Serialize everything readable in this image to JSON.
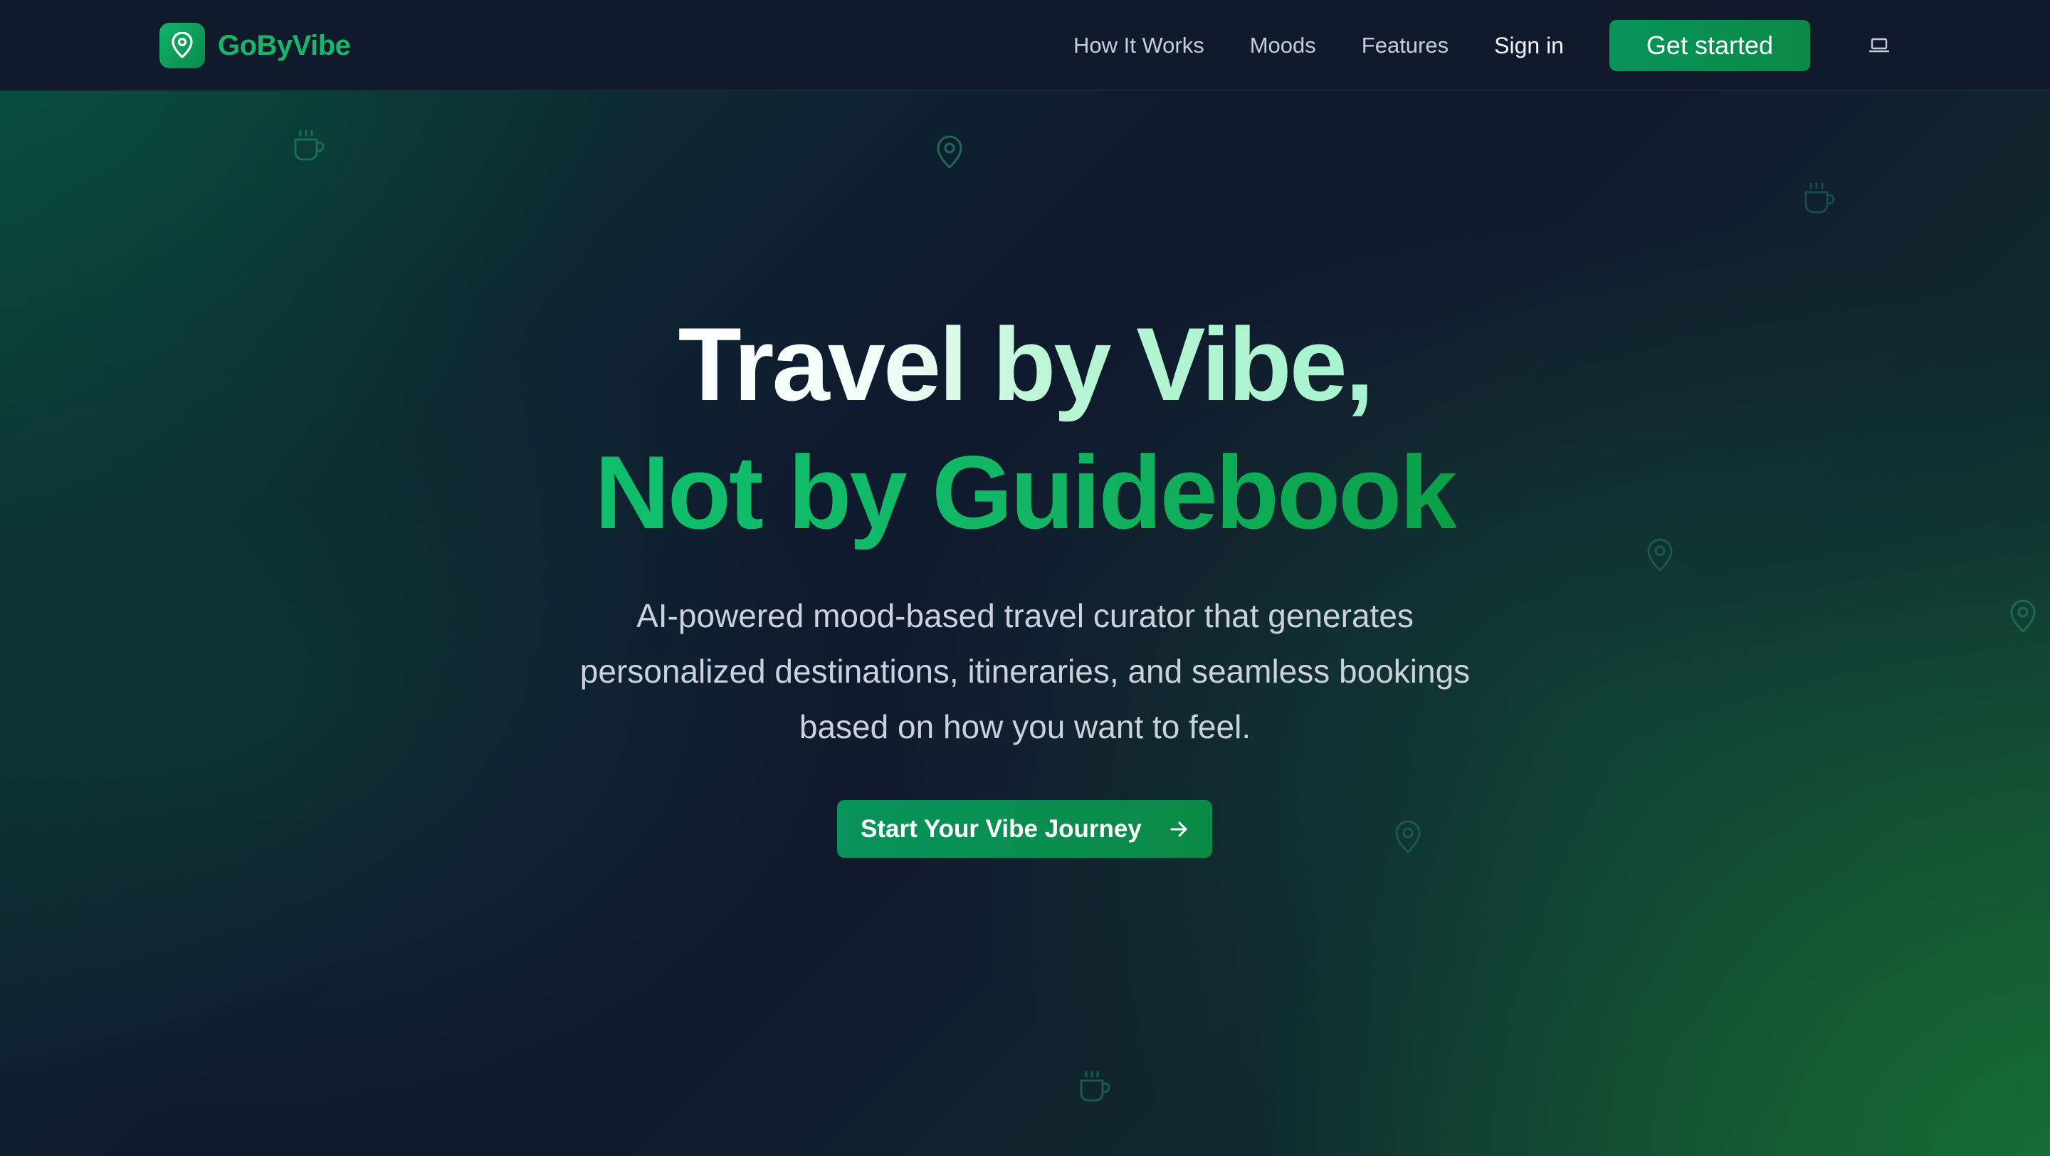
{
  "header": {
    "brand": {
      "name": "GoByVibe",
      "icon": "map-pin-icon"
    },
    "nav": {
      "links": [
        "How It Works",
        "Moods",
        "Features"
      ],
      "sign_in": "Sign in",
      "get_started": "Get started",
      "theme_toggle_icon": "laptop-icon"
    }
  },
  "hero": {
    "title_line1": "Travel by Vibe,",
    "title_line2": "Not by Guidebook",
    "subtitle": "AI-powered mood-based travel curator that generates personalized destinations, itineraries, and seamless bookings based on how you want to feel.",
    "cta_label": "Start Your Vibe Journey",
    "cta_icon": "arrow-right-icon"
  },
  "decorations": {
    "icons": [
      "coffee-cup-icon",
      "map-pin-icon",
      "coffee-cup-icon",
      "map-pin-icon",
      "map-pin-icon",
      "map-pin-icon",
      "coffee-cup-icon"
    ]
  },
  "colors": {
    "brand_green": "#16b768",
    "button_green": "#07935b",
    "header_bg": "#111a2b",
    "page_bg": "#0f172a"
  }
}
